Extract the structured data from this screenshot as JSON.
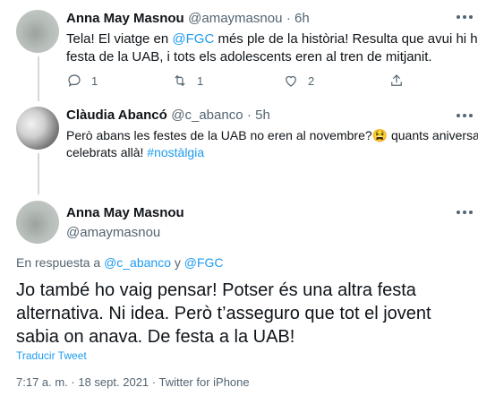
{
  "tweet1": {
    "name": "Anna May Masnou",
    "handle": "@amaymasnou",
    "time": "· 6h",
    "text_a": "Tela! El viatge en ",
    "mention": "@FGC",
    "text_b": " més ple de la història! Resulta que avui hi ha la",
    "text_line2": "festa de la UAB, i tots els adolescents eren al tren de mitjanit.",
    "replies": "1",
    "retweets": "1",
    "likes": "2"
  },
  "tweet2": {
    "name": "Clàudia Abancó",
    "handle": "@c_abanco",
    "time": "· 5h",
    "text_line1": "Però abans les festes de la UAB no eren al novembre?",
    "emoji": "😫",
    "text_line1b": " quants aniversaris",
    "text_line2": "celebrats allà! ",
    "hashtag": "#nostàlgia"
  },
  "main_tweet": {
    "name": "Anna May Masnou",
    "handle": "@amaymasnou",
    "reply_prefix": "En respuesta a ",
    "reply_to_1": "@c_abanco",
    "reply_and": " y ",
    "reply_to_2": "@FGC",
    "text_line1": "Jo també ho vaig pensar! Potser és una altra festa",
    "text_line2": "alternativa. Ni idea. Però t’asseguro que tot el jovent",
    "text_line3": "sabia on anava. De festa a la UAB!",
    "translate": "Traducir Tweet",
    "timestamp": "7:17 a. m. · 18 sept. 2021 · Twitter for iPhone"
  },
  "colors": {
    "accent": "#1d9bf0",
    "secondary_text": "#536471",
    "line": "#cfd9de"
  }
}
